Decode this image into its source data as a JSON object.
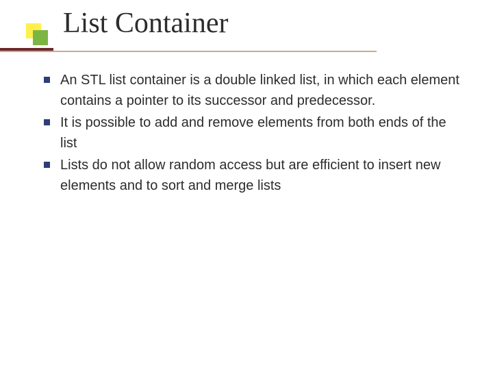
{
  "title": "List Container",
  "bullets": [
    {
      "text": "An STL list container is a double linked list, in which each element contains a pointer to its successor and predecessor."
    },
    {
      "text": "It is possible to add and remove elements from both ends of the list"
    },
    {
      "text": "Lists do not allow random access but are efficient to insert new elements and to sort and merge lists"
    }
  ]
}
